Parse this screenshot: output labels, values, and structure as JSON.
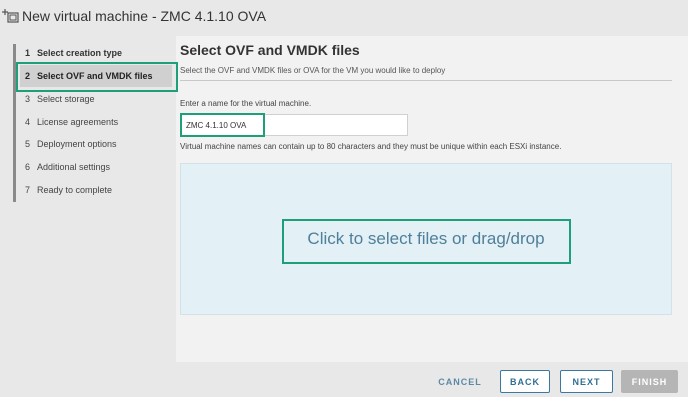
{
  "window": {
    "title": "New virtual machine - ZMC 4.1.10 OVA",
    "icon": "new-vm-icon"
  },
  "sidebar": {
    "steps": [
      {
        "num": "1",
        "label": "Select creation type",
        "state": "done"
      },
      {
        "num": "2",
        "label": "Select OVF and VMDK files",
        "state": "active"
      },
      {
        "num": "3",
        "label": "Select storage",
        "state": "pending"
      },
      {
        "num": "4",
        "label": "License agreements",
        "state": "pending"
      },
      {
        "num": "5",
        "label": "Deployment options",
        "state": "pending"
      },
      {
        "num": "6",
        "label": "Additional settings",
        "state": "pending"
      },
      {
        "num": "7",
        "label": "Ready to complete",
        "state": "pending"
      }
    ]
  },
  "main": {
    "heading": "Select OVF and VMDK files",
    "subheading": "Select the OVF and VMDK files or OVA for the VM you would like to deploy",
    "name_label": "Enter a name for the virtual machine.",
    "name_value": "ZMC 4.1.10 OVA",
    "name_hint": "Virtual machine names can contain up to 80 characters and they must be unique within each ESXi instance.",
    "dropzone_text": "Click to select files or drag/drop"
  },
  "footer": {
    "cancel": "CANCEL",
    "back": "BACK",
    "next": "NEXT",
    "finish": "FINISH"
  },
  "colors": {
    "highlight": "#1f9e7a",
    "dropzone_bg": "#e3f0f5",
    "link": "#2f6f94",
    "disabled": "#b5b5b5"
  }
}
